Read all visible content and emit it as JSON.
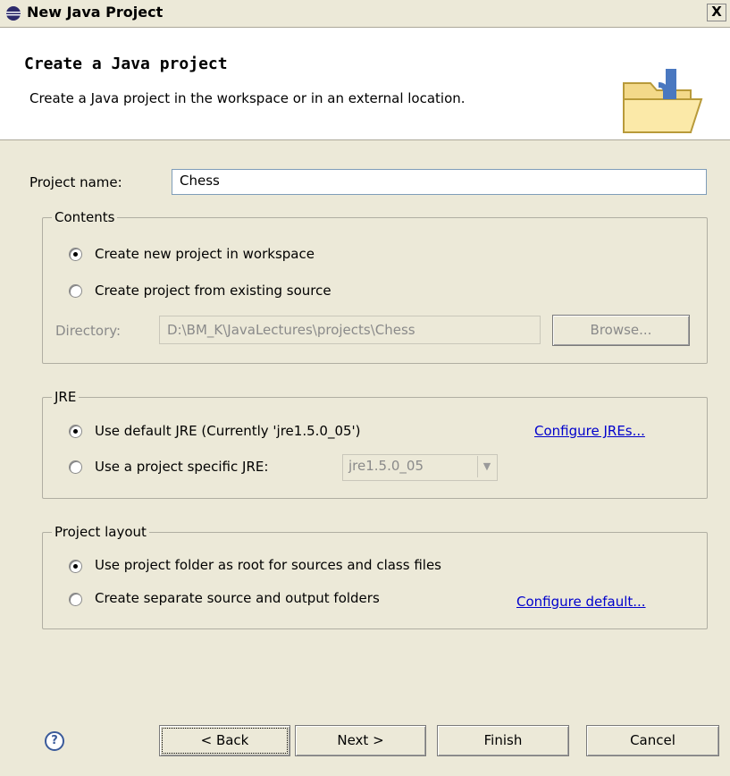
{
  "window": {
    "title": "New Java Project",
    "close_label": "X"
  },
  "banner": {
    "heading": "Create a Java project",
    "description": "Create a Java project in the workspace or in an external location."
  },
  "project_name": {
    "label": "Project name:",
    "value": "Chess"
  },
  "contents": {
    "title": "Contents",
    "option_workspace": "Create new project in workspace",
    "option_existing": "Create project from existing source",
    "directory_label": "Directory:",
    "directory_value": "D:\\BM_K\\JavaLectures\\projects\\Chess",
    "browse_label": "Browse...",
    "selected": "workspace"
  },
  "jre": {
    "title": "JRE",
    "option_default": "Use default JRE (Currently 'jre1.5.0_05')",
    "configure_link": "Configure JREs...",
    "option_specific": "Use a project specific JRE:",
    "specific_value": "jre1.5.0_05",
    "selected": "default"
  },
  "layout": {
    "title": "Project layout",
    "option_root": "Use project folder as root for sources and class files",
    "option_separate": "Create separate source and output folders",
    "configure_link": "Configure default...",
    "selected": "root"
  },
  "buttons": {
    "back": "< Back",
    "next": "Next >",
    "finish": "Finish",
    "cancel": "Cancel",
    "help": "?"
  },
  "colors": {
    "link": "#0000cc",
    "title_bar": "#ece9d8",
    "banner_bg": "#ffffff"
  },
  "icons": {
    "app": "eclipse-icon",
    "wizard": "java-project-folder-icon",
    "help": "help-icon"
  }
}
